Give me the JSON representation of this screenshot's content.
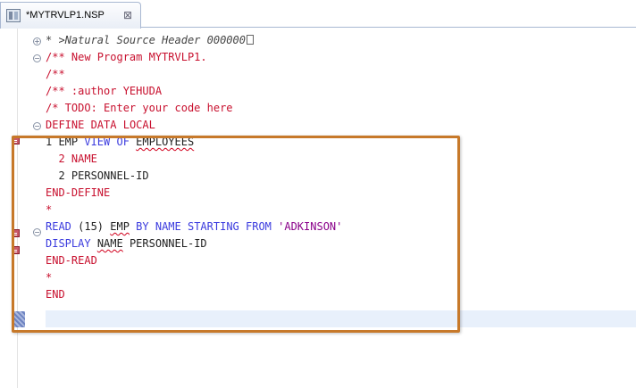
{
  "tab": {
    "label": "*MYTRVLP1.NSP",
    "icon": "natural-program-icon",
    "close_glyph": "⊠"
  },
  "colors": {
    "keyword": "#3b3bde",
    "comment": "#c8102e",
    "string": "#8a008a",
    "error_marker": "#c85a6a",
    "highlight_frame": "#c7792a"
  },
  "editor": {
    "line1_prefix": "* ",
    "line1_comment": ">Natural Source Header 000000",
    "line2": "/** New Program MYTRVLP1.",
    "line3": "/**",
    "line4": "/** :author YEHUDA",
    "line5": "/* TODO: Enter your code here",
    "line6_kw1": "DEFINE DATA",
    "line6_kw2": "LOCAL",
    "line7_a": "1 EMP ",
    "line7_kw": "VIEW OF",
    "line7_b": "EMPLOYEES",
    "line8": "  2 NAME",
    "line9": "  2 PERSONNEL-ID",
    "line10": "END-DEFINE",
    "line11": "*",
    "line12_kw1": "READ",
    "line12_a": " (15) ",
    "line12_emp": "EMP",
    "line12_kw2": " BY NAME STARTING FROM ",
    "line12_str": "'ADKINSON'",
    "line13_kw": "DISPLAY",
    "line13_name": "NAME",
    "line13_rest": " PERSONNEL-ID",
    "line14": "END-READ",
    "line15": "*",
    "line16": "END"
  }
}
